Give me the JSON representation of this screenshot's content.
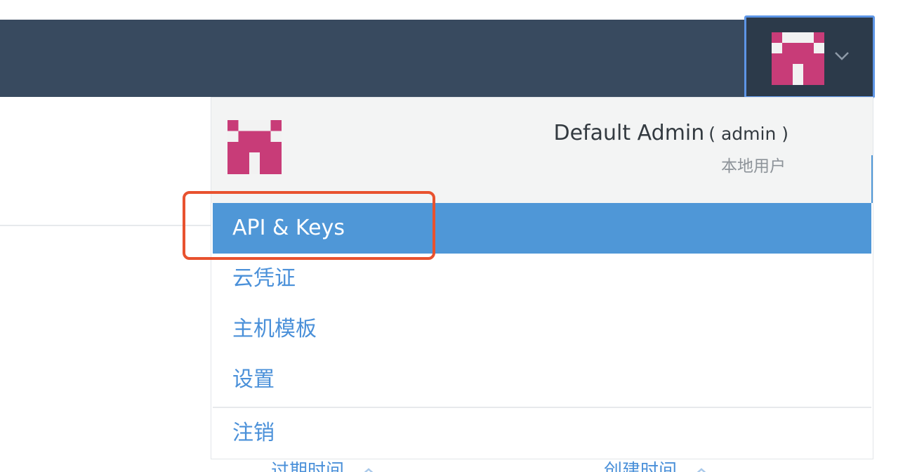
{
  "user_menu": {
    "name": "Default Admin",
    "login": "( admin )",
    "user_type": "本地用户",
    "items": [
      {
        "label": "API & Keys",
        "active": true
      },
      {
        "label": "云凭证",
        "active": false
      },
      {
        "label": "主机模板",
        "active": false
      },
      {
        "label": "设置",
        "active": false
      },
      {
        "label": "注销",
        "active": false
      }
    ]
  },
  "background_table": {
    "columns": [
      "过期时间",
      "创建时间"
    ]
  },
  "colors": {
    "topbar": "#384a5f",
    "active_item": "#4f97d7",
    "link_text": "#4a90d9",
    "annotation": "#e8522f",
    "avatar": "#c83c78"
  },
  "icons": {
    "avatar": "identicon-avatar",
    "dropdown": "chevron-down-icon",
    "sort": "sort-asc-icon"
  }
}
